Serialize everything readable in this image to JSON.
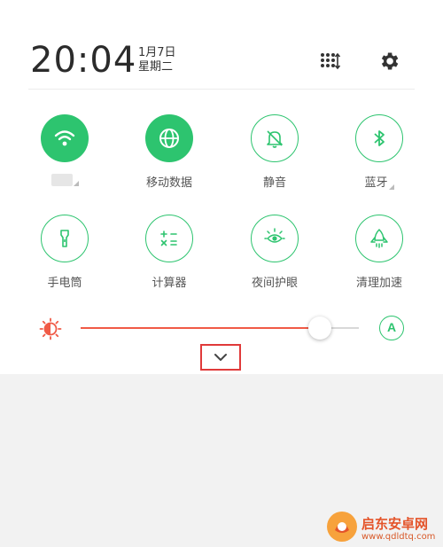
{
  "header": {
    "time": "20:04",
    "date": "1月7日",
    "weekday": "星期二"
  },
  "tiles": [
    {
      "label": "",
      "icon": "wifi-icon",
      "state": "on"
    },
    {
      "label": "移动数据",
      "icon": "globe-icon",
      "state": "on"
    },
    {
      "label": "静音",
      "icon": "bell-icon",
      "state": "off"
    },
    {
      "label": "蓝牙",
      "icon": "bluetooth-icon",
      "state": "off"
    },
    {
      "label": "手电筒",
      "icon": "flashlight-icon",
      "state": "off"
    },
    {
      "label": "计算器",
      "icon": "calculator-icon",
      "state": "off"
    },
    {
      "label": "夜间护眼",
      "icon": "eye-icon",
      "state": "off"
    },
    {
      "label": "清理加速",
      "icon": "rocket-icon",
      "state": "off"
    }
  ],
  "brightness": {
    "level": 0.86,
    "auto_label": "A"
  },
  "colors": {
    "accent": "#2dc46f",
    "brightness": "#f05a46",
    "highlight_box": "#e03a3a"
  },
  "watermark": {
    "title": "启东安卓网",
    "url": "www.qdldtq.com"
  }
}
